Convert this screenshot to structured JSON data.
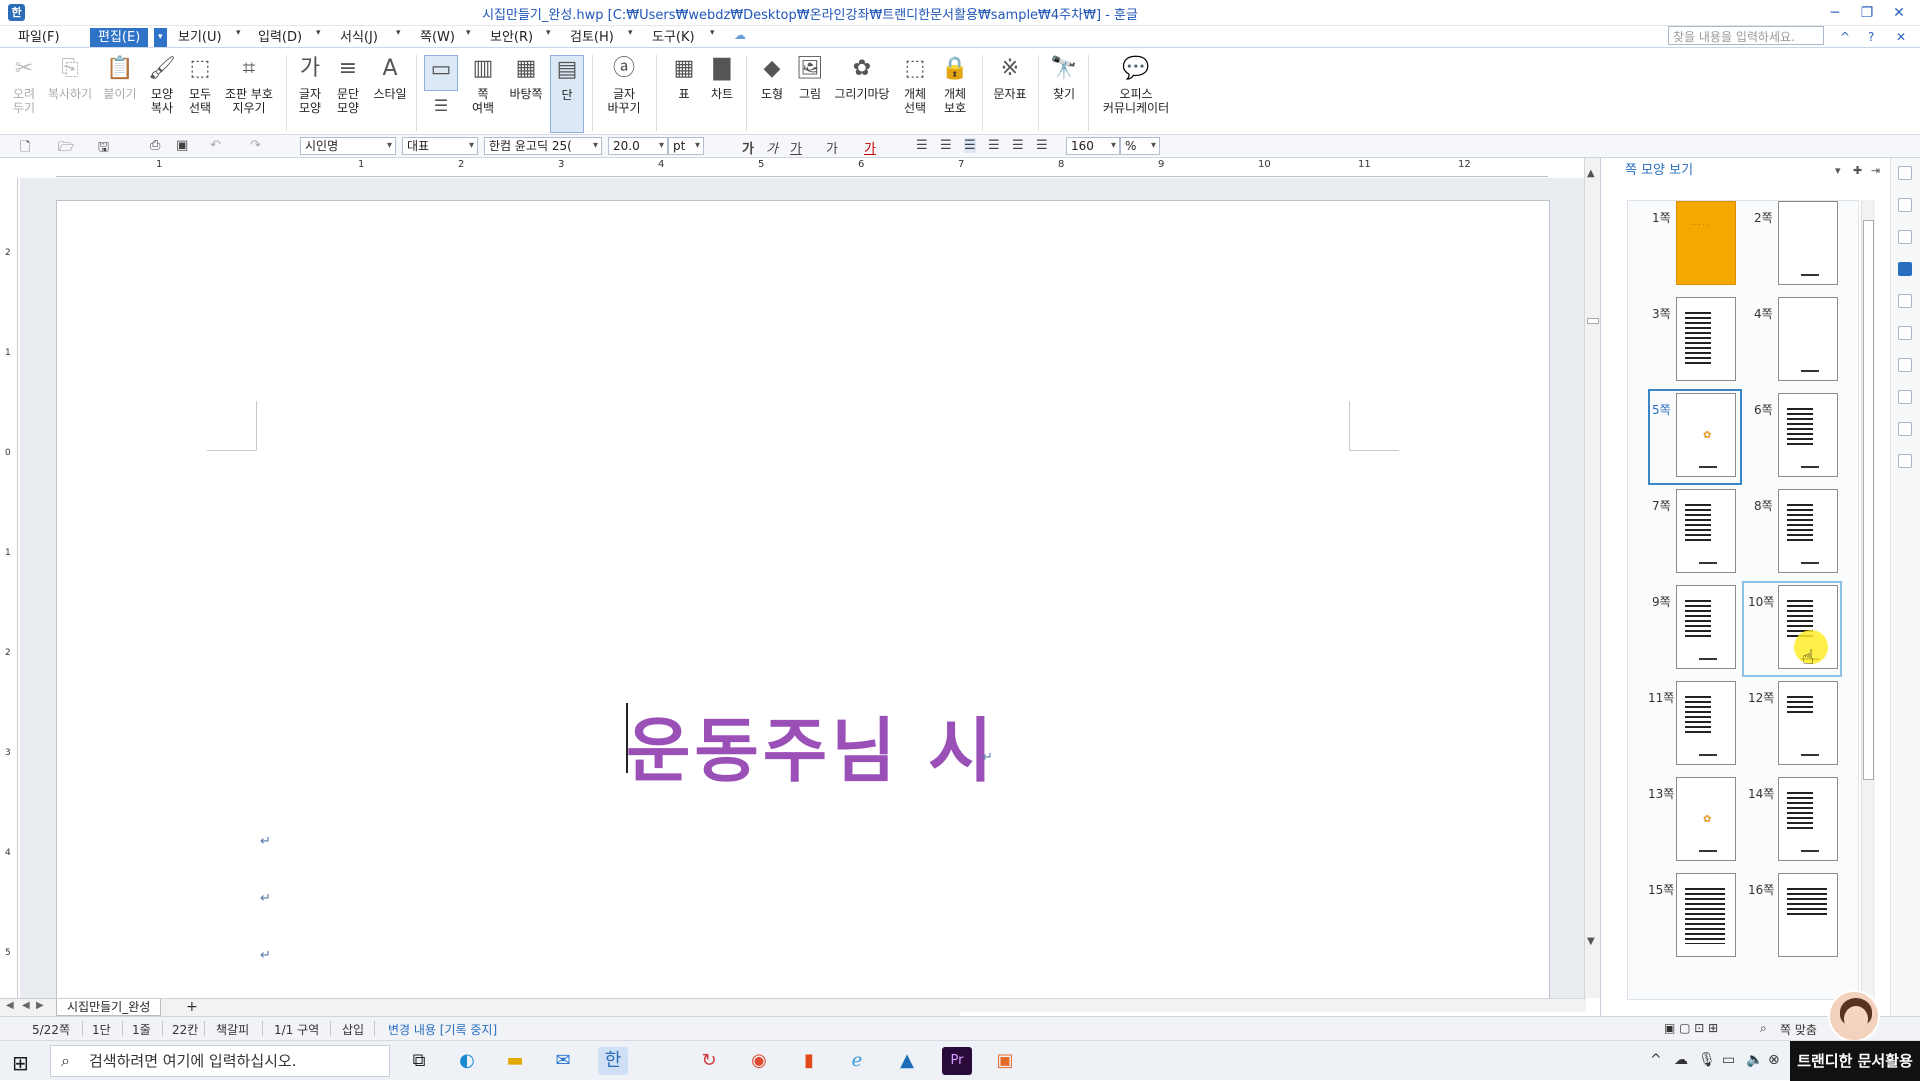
{
  "window": {
    "title": "시집만들기_완성.hwp [C:₩Users₩webdz₩Desktop₩온라인강좌₩트랜디한문서활용₩sample₩4주차₩] - 훈글",
    "app_icon": "hwp-app-icon",
    "controls": [
      "─",
      "❐",
      "✕"
    ]
  },
  "menubar": {
    "items": [
      "파일(F)",
      "편집(E)",
      "보기(U)",
      "입력(D)",
      "서식(J)",
      "쪽(W)",
      "보안(R)",
      "검토(H)",
      "도구(K)"
    ],
    "active_index": 1,
    "search_placeholder": "찾을 내용을 입력하세요.",
    "right_icons": [
      "^",
      "?",
      "✕"
    ]
  },
  "ribbon": {
    "buttons": [
      {
        "icon": "✂",
        "label": "오려\n두기",
        "disabled": true
      },
      {
        "icon": "⎘",
        "label": "복사하기",
        "disabled": true
      },
      {
        "icon": "📋",
        "label": "붙이기",
        "disabled": true
      },
      {
        "icon": "🖌",
        "label": "모양\n복사",
        "disabled": false
      },
      {
        "icon": "⬚",
        "label": "모두\n선택",
        "disabled": false
      },
      {
        "icon": "⌗",
        "label": "조판 부호\n지우기",
        "disabled": false
      },
      {
        "icon": "가",
        "label": "글자\n모양",
        "disabled": false
      },
      {
        "icon": "≡",
        "label": "문단\n모양",
        "disabled": false
      },
      {
        "icon": "A",
        "label": "스타일",
        "disabled": false
      },
      {
        "icon": "▭",
        "label": "",
        "disabled": false
      },
      {
        "icon": "▥",
        "label": "쪽\n여백",
        "disabled": false
      },
      {
        "icon": "▦",
        "label": "바탕쪽",
        "disabled": false
      },
      {
        "icon": "▤",
        "label": "단",
        "disabled": false
      },
      {
        "icon": "ⓐ",
        "label": "글자\n바꾸기",
        "disabled": false
      },
      {
        "icon": "▦",
        "label": "표",
        "disabled": false
      },
      {
        "icon": "▇",
        "label": "차트",
        "disabled": false
      },
      {
        "icon": "◆",
        "label": "도형",
        "disabled": false
      },
      {
        "icon": "🖼",
        "label": "그림",
        "disabled": false
      },
      {
        "icon": "✿",
        "label": "그리기마당",
        "disabled": false
      },
      {
        "icon": "⬚",
        "label": "개체\n선택",
        "disabled": false
      },
      {
        "icon": "🔒",
        "label": "개체\n보호",
        "disabled": false
      },
      {
        "icon": "※",
        "label": "문자표",
        "disabled": false
      },
      {
        "icon": "🔭",
        "label": "찾기",
        "disabled": false
      },
      {
        "icon": "💬",
        "label": "오피스\n커뮤니케이터",
        "disabled": false
      }
    ]
  },
  "format_toolbar": {
    "style": "시인명",
    "lang": "대표",
    "font": "한컴 윤고딕 25(",
    "size": "20.0",
    "unit": "pt",
    "zoom": "160",
    "zoom_unit": "%"
  },
  "ruler": {
    "numbers": [
      "1",
      "1",
      "2",
      "3",
      "4",
      "5",
      "6",
      "7",
      "8",
      "9",
      "10",
      "11",
      "12"
    ],
    "vnumbers": [
      "2",
      "1",
      "0",
      "1",
      "2",
      "3",
      "4",
      "5"
    ]
  },
  "document": {
    "heading": "운동주님 시",
    "para_mark": "↵"
  },
  "tabs": {
    "active": "시집만들기_완성",
    "add": "+"
  },
  "statusbar": {
    "items": [
      "5/22쪽",
      "1단",
      "1줄",
      "22칸",
      "책갈피",
      "1/1 구역",
      "삽입",
      "변경 내용 [기록 중지]"
    ],
    "fit": "쪽 맞춤"
  },
  "panel": {
    "title": "쪽 모양 보기",
    "pages": [
      "1쪽",
      "2쪽",
      "3쪽",
      "4쪽",
      "5쪽",
      "6쪽",
      "7쪽",
      "8쪽",
      "9쪽",
      "10쪽",
      "11쪽",
      "12쪽",
      "13쪽",
      "14쪽",
      "15쪽",
      "16쪽"
    ],
    "selected_page": "5쪽",
    "hover_page": "10쪽",
    "cover_color": "#F5A800"
  },
  "taskbar": {
    "search_placeholder": "검색하려면 여기에 입력하십시오.",
    "brand": "트랜디한 문서활용"
  }
}
